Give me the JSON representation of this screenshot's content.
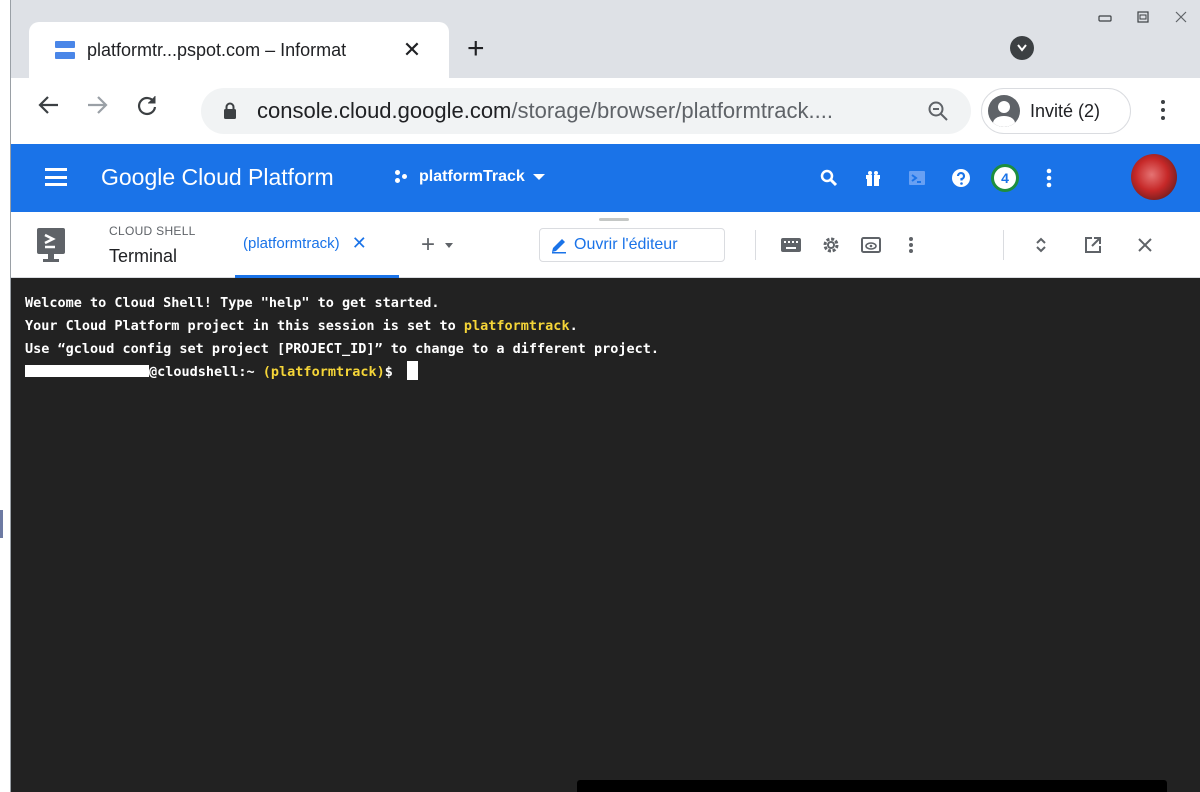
{
  "browser": {
    "tab": {
      "title": "platformtr...pspot.com – Informat",
      "close": "✕"
    },
    "new_tab": "+",
    "url_host": "console.cloud.google.com",
    "url_path": "/storage/browser/platformtrack....",
    "profile_label": "Invité (2)",
    "icons": [
      "back-arrow-icon",
      "forward-arrow-icon",
      "reload-icon",
      "lock-icon",
      "zoom-icon",
      "profile-icon",
      "kebab-menu-icon"
    ]
  },
  "gcp": {
    "title": "Google Cloud Platform",
    "project": "platformTrack",
    "notification_count": "4",
    "icons": [
      "hamburger-icon",
      "search-icon",
      "gift-icon",
      "cloud-shell-icon",
      "help-icon",
      "kebab-menu-icon",
      "user-avatar"
    ]
  },
  "shell": {
    "label_small": "CLOUD SHELL",
    "label_big": "Terminal",
    "session_tab": "(platformtrack)",
    "session_close": "✕",
    "add_session": "+",
    "editor_button": "Ouvrir l'éditeur",
    "icons": [
      "keyboard-icon",
      "settings-icon",
      "web-preview-icon",
      "kebab-menu-icon",
      "expand-icon",
      "open-new-window-icon",
      "close-icon"
    ]
  },
  "terminal": {
    "line1": "Welcome to Cloud Shell! Type \"help\" to get started.",
    "line2_prefix": "Your Cloud Platform project in this session is set to ",
    "line2_project": "platformtrack",
    "line2_suffix": ".",
    "line3": "Use “gcloud config set project [PROJECT_ID]” to change to a different project.",
    "prompt_host": "@cloudshell:~ ",
    "prompt_project": "(platformtrack)",
    "prompt_symbol": "$ "
  },
  "colors": {
    "gcp_blue": "#1a73e8",
    "terminal_bg": "#222222",
    "terminal_highlight": "#f5d538"
  }
}
